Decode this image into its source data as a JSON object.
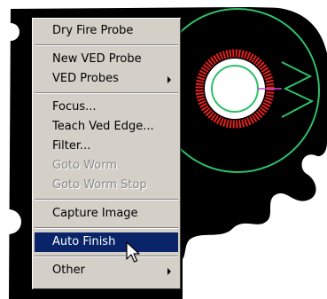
{
  "menu": {
    "items": [
      {
        "label": "Dry Fire Probe",
        "enabled": true
      },
      {
        "separator": true
      },
      {
        "label": "New VED Probe",
        "enabled": true
      },
      {
        "label": "VED Probes",
        "enabled": true,
        "submenu": true
      },
      {
        "separator": true
      },
      {
        "label": "Focus...",
        "enabled": true
      },
      {
        "label": "Teach Ved Edge...",
        "enabled": true
      },
      {
        "label": "Filter...",
        "enabled": true
      },
      {
        "label": "Goto Worm",
        "enabled": false
      },
      {
        "label": "Goto Worm Stop",
        "enabled": false
      },
      {
        "separator": true
      },
      {
        "label": "Capture Image",
        "enabled": true
      },
      {
        "separator": true
      },
      {
        "label": "Auto Finish",
        "enabled": true,
        "selected": true
      },
      {
        "separator": true
      },
      {
        "label": "Other",
        "enabled": true,
        "submenu": true
      }
    ]
  },
  "colors": {
    "menu_bg": "#d4d0c8",
    "selection": "#0a246a",
    "probe_green": "#2fbf6a",
    "probe_red": "#e02020",
    "workspace": "#000000"
  },
  "cursor": {
    "icon": "arrow-cursor-icon"
  }
}
